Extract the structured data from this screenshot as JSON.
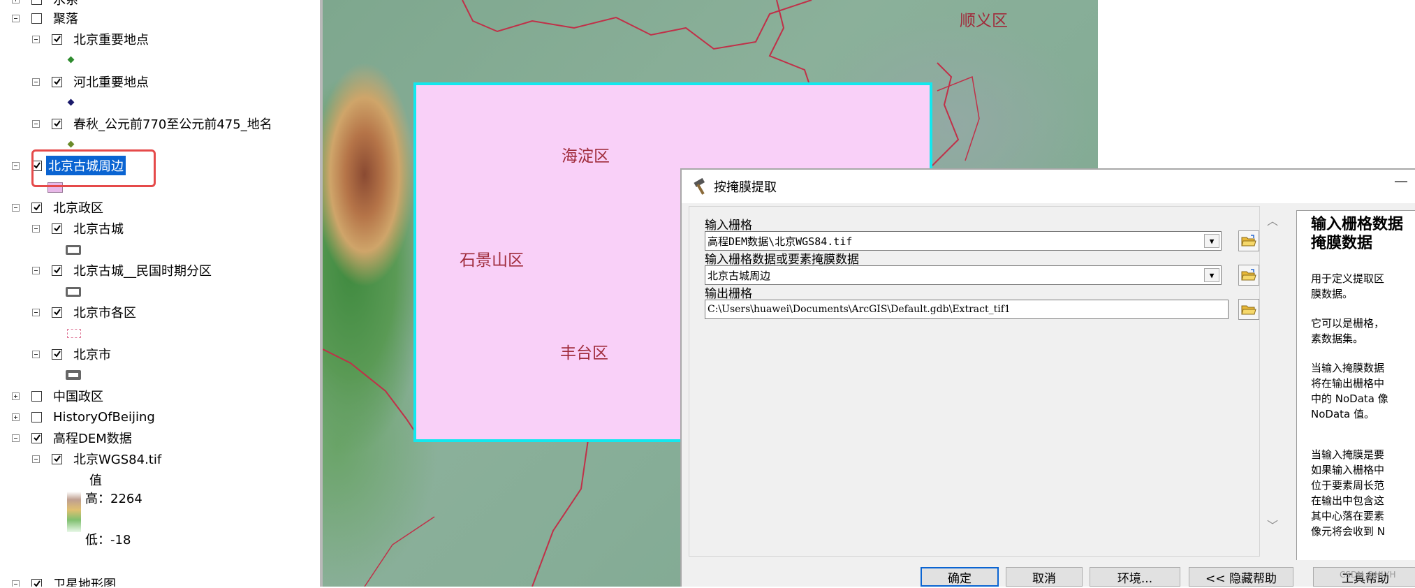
{
  "toc": {
    "layers": [
      {
        "id": "shuixi",
        "label": "水系",
        "expand": "plus",
        "checked": false
      },
      {
        "id": "juluo",
        "label": "聚落",
        "expand": "minus",
        "checked": false
      },
      {
        "id": "bj-places",
        "label": "北京重要地点",
        "expand": "minus",
        "checked": true,
        "symbol_color": "#2e8b2e"
      },
      {
        "id": "hb-places",
        "label": "河北重要地点",
        "expand": "minus",
        "checked": true,
        "symbol_color": "#1a1a6a"
      },
      {
        "id": "chunqiu",
        "label": "春秋_公元前770至公元前475_地名",
        "expand": "minus",
        "checked": true,
        "symbol_color": "#6a8a2a"
      },
      {
        "id": "gucheng-zhoubian",
        "label": "北京古城周边",
        "expand": "minus",
        "checked": true,
        "selected": true,
        "symbol_color": "#e8b8e8"
      },
      {
        "id": "bj-zhengqu",
        "label": "北京政区",
        "expand": "minus",
        "checked": true
      },
      {
        "id": "bj-gucheng",
        "label": "北京古城",
        "expand": "minus",
        "checked": true
      },
      {
        "id": "bj-gucheng-mg",
        "label": "北京古城__民国时期分区",
        "expand": "minus",
        "checked": true
      },
      {
        "id": "bj-gequ",
        "label": "北京市各区",
        "expand": "minus",
        "checked": true
      },
      {
        "id": "bj-shi",
        "label": "北京市",
        "expand": "minus",
        "checked": true
      },
      {
        "id": "cn-zhengqu",
        "label": "中国政区",
        "expand": "plus",
        "checked": false
      },
      {
        "id": "history",
        "label": "HistoryOfBeijing",
        "expand": "plus",
        "checked": false
      },
      {
        "id": "dem",
        "label": "高程DEM数据",
        "expand": "minus",
        "checked": true
      },
      {
        "id": "wgs84",
        "label": "北京WGS84.tif",
        "expand": "minus",
        "checked": true
      },
      {
        "id": "weixing",
        "label": "卫星地形图",
        "expand": "minus",
        "checked": true
      }
    ],
    "legend": {
      "value_label": "值",
      "high": "高：2264",
      "low": "低：-18"
    }
  },
  "map": {
    "labels": {
      "shunyi": "顺义区",
      "haidian": "海淀区",
      "shijingshan": "石景山区",
      "fengtai": "丰台区"
    },
    "mask_color": "#f9d0f8",
    "mask_border": "#12e8ee"
  },
  "dialog": {
    "title": "按掩膜提取",
    "min_glyph": "—",
    "input_raster": {
      "label": "输入栅格",
      "value": "高程DEM数据\\北京WGS84.tif"
    },
    "mask": {
      "label": "输入栅格数据或要素掩膜数据",
      "value": "北京古城周边"
    },
    "output": {
      "label": "输出栅格",
      "value": "C:\\Users\\huawei\\Documents\\ArcGIS\\Default.gdb\\Extract_tif1"
    },
    "help": {
      "title_l1": "输入栅格数据",
      "title_l2": "掩膜数据",
      "p1": [
        "用于定义提取区",
        "膜数据。"
      ],
      "p2": [
        "它可以是栅格，",
        "素数据集。"
      ],
      "p3": [
        "当输入掩膜数据",
        "将在输出栅格中",
        "中的 NoData 像",
        "NoData 值。"
      ],
      "p4": [
        "当输入掩膜是要",
        "如果输入栅格中",
        "位于要素周长范",
        "在输出中包含这",
        "其中心落在要素",
        "像元将会收到 N"
      ]
    },
    "buttons": {
      "ok": "确定",
      "cancel": "取消",
      "env": "环境...",
      "hide_help": "<< 隐藏帮助",
      "tool_help": "工具帮助"
    }
  },
  "watermark": "CSDN @HLYH"
}
